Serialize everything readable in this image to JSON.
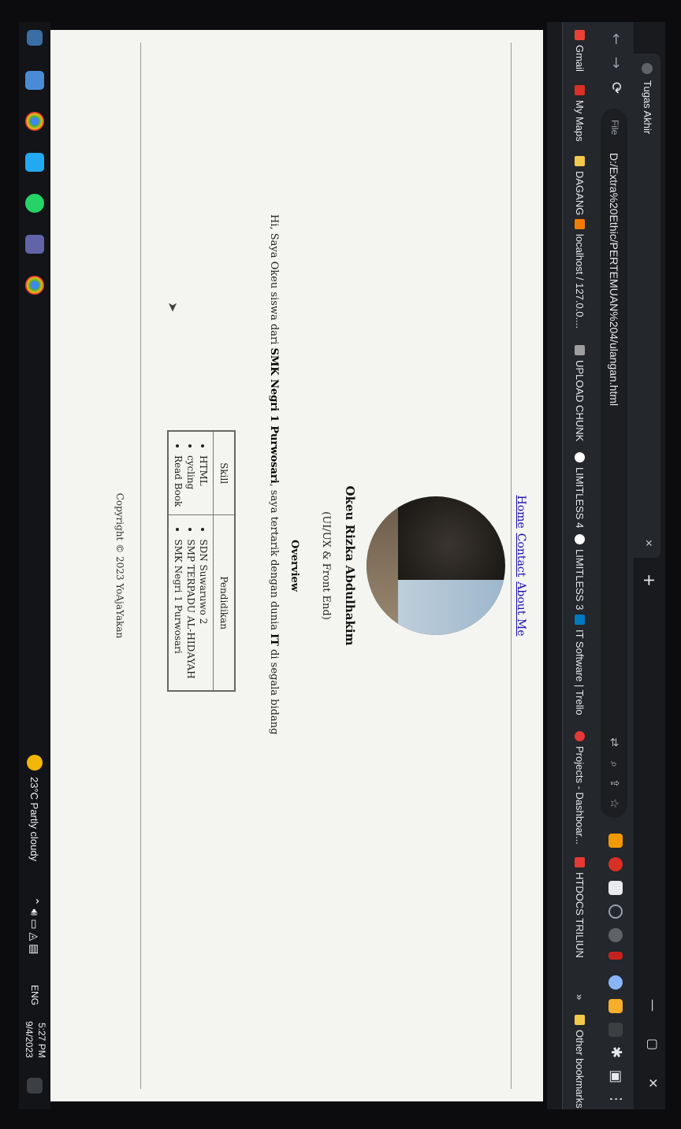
{
  "browser": {
    "tab_title": "Tugas Akhir",
    "tab_close": "×",
    "new_tab": "+",
    "url": "D:/Extra%20Ethic/PERTEMUAN%204/ulangan.html",
    "info_label": "File",
    "win_controls": [
      "—",
      "▢",
      "✕"
    ]
  },
  "bookmarks": [
    {
      "label": "Gmail",
      "color": "#ea4335"
    },
    {
      "label": "My Maps",
      "color": "#d93025"
    },
    {
      "label": "DAGANG",
      "color": "#f2c94c"
    },
    {
      "label": "localhost / 127.0.0....",
      "color": "#f57c00"
    },
    {
      "label": "UPLOAD CHUNK",
      "color": "#9e9e9e"
    },
    {
      "label": "LIMITLESS 4",
      "color": "#ffffff"
    },
    {
      "label": "LIMITLESS 3",
      "color": "#ffffff"
    },
    {
      "label": "IT Software | Trello",
      "color": "#0079bf"
    },
    {
      "label": "Projects - Dashboar...",
      "color": "#e53935"
    },
    {
      "label": "HTDOCS TRILIUN",
      "color": "#e53935"
    },
    {
      "label": "»",
      "color": ""
    },
    {
      "label": "Other bookmarks",
      "color": "#f2c94c"
    }
  ],
  "page": {
    "nav": [
      "Home",
      "Contact",
      "About Me"
    ],
    "name": "Okeu Rizka Abdulhakim",
    "role": "(UI/UX & Front End)",
    "overview_heading": "Overview",
    "intro_pre": "Hi, Saya Okeu siswa dari ",
    "intro_school": "SMK Negri 1 Purwosari",
    "intro_mid": ", saya tertarik dengan dunia ",
    "intro_it": "IT",
    "intro_post": " di segala bidang",
    "table": {
      "headers": [
        "Skill",
        "Pendidikan"
      ],
      "skills": [
        "HTML",
        "cycling",
        "Read Book"
      ],
      "education": [
        "SDN Suwaruwo 2",
        "SMP TERPADU AL-HIDAYAH",
        "SMK Negri 1 Purwosari"
      ]
    },
    "copyright": "Copyright © 2023 YoAjaYakan"
  },
  "taskbar": {
    "weather": "23°C  Partly cloudy",
    "lang": "ENG",
    "time": "5:27 PM",
    "date": "9/4/2023"
  }
}
